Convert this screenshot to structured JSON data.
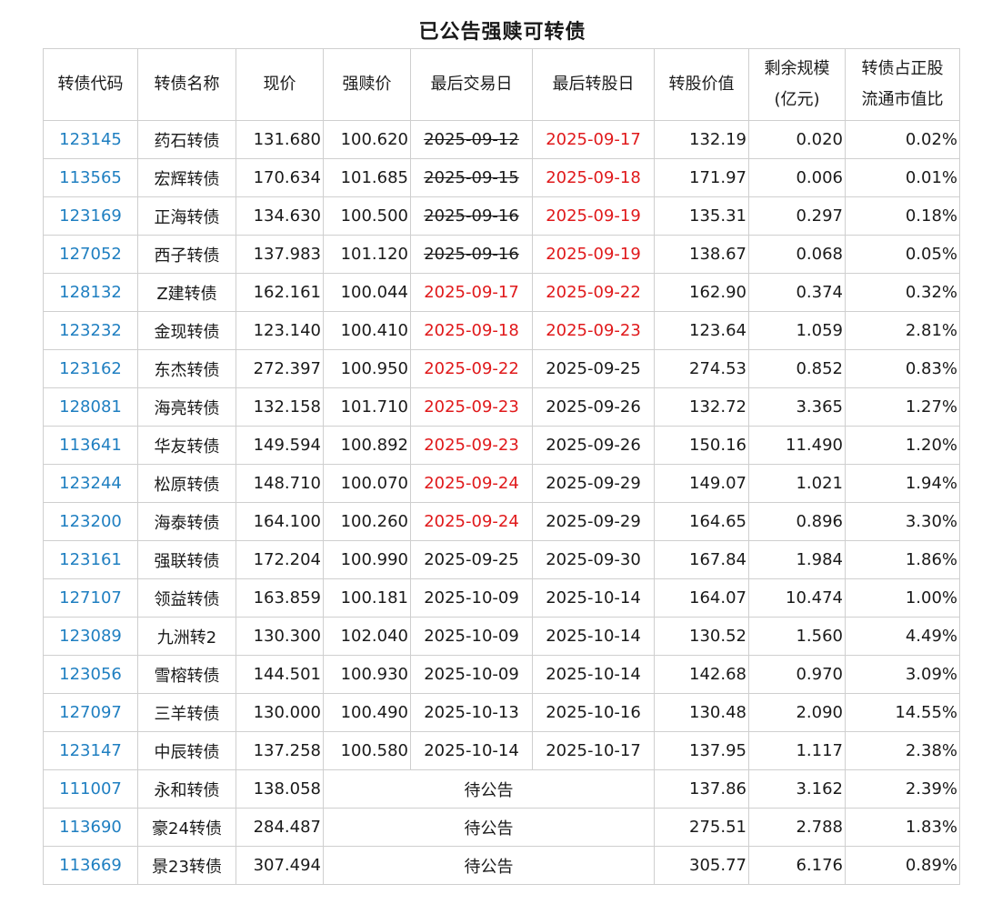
{
  "title": "已公告强赎可转债",
  "columns": [
    "转债代码",
    "转债名称",
    "现价",
    "强赎价",
    "最后交易日",
    "最后转股日",
    "转股价值",
    "剩余规模\n(亿元)",
    "转债占正股\n流通市值比"
  ],
  "rows": [
    {
      "code": "123145",
      "name": "药石转债",
      "price": "131.680",
      "redeem": "100.620",
      "last_trade": "2025-09-12",
      "last_trade_style": "strike",
      "last_convert": "2025-09-17",
      "last_convert_style": "red",
      "conv_value": "132.19",
      "remaining": "0.020",
      "ratio": "0.02%"
    },
    {
      "code": "113565",
      "name": "宏辉转债",
      "price": "170.634",
      "redeem": "101.685",
      "last_trade": "2025-09-15",
      "last_trade_style": "strike",
      "last_convert": "2025-09-18",
      "last_convert_style": "red",
      "conv_value": "171.97",
      "remaining": "0.006",
      "ratio": "0.01%"
    },
    {
      "code": "123169",
      "name": "正海转债",
      "price": "134.630",
      "redeem": "100.500",
      "last_trade": "2025-09-16",
      "last_trade_style": "strike",
      "last_convert": "2025-09-19",
      "last_convert_style": "red",
      "conv_value": "135.31",
      "remaining": "0.297",
      "ratio": "0.18%"
    },
    {
      "code": "127052",
      "name": "西子转债",
      "price": "137.983",
      "redeem": "101.120",
      "last_trade": "2025-09-16",
      "last_trade_style": "strike",
      "last_convert": "2025-09-19",
      "last_convert_style": "red",
      "conv_value": "138.67",
      "remaining": "0.068",
      "ratio": "0.05%"
    },
    {
      "code": "128132",
      "name": "Z建转债",
      "price": "162.161",
      "redeem": "100.044",
      "last_trade": "2025-09-17",
      "last_trade_style": "red",
      "last_convert": "2025-09-22",
      "last_convert_style": "red",
      "conv_value": "162.90",
      "remaining": "0.374",
      "ratio": "0.32%"
    },
    {
      "code": "123232",
      "name": "金现转债",
      "price": "123.140",
      "redeem": "100.410",
      "last_trade": "2025-09-18",
      "last_trade_style": "red",
      "last_convert": "2025-09-23",
      "last_convert_style": "red",
      "conv_value": "123.64",
      "remaining": "1.059",
      "ratio": "2.81%"
    },
    {
      "code": "123162",
      "name": "东杰转债",
      "price": "272.397",
      "redeem": "100.950",
      "last_trade": "2025-09-22",
      "last_trade_style": "red",
      "last_convert": "2025-09-25",
      "last_convert_style": "normal",
      "conv_value": "274.53",
      "remaining": "0.852",
      "ratio": "0.83%"
    },
    {
      "code": "128081",
      "name": "海亮转债",
      "price": "132.158",
      "redeem": "101.710",
      "last_trade": "2025-09-23",
      "last_trade_style": "red",
      "last_convert": "2025-09-26",
      "last_convert_style": "normal",
      "conv_value": "132.72",
      "remaining": "3.365",
      "ratio": "1.27%"
    },
    {
      "code": "113641",
      "name": "华友转债",
      "price": "149.594",
      "redeem": "100.892",
      "last_trade": "2025-09-23",
      "last_trade_style": "red",
      "last_convert": "2025-09-26",
      "last_convert_style": "normal",
      "conv_value": "150.16",
      "remaining": "11.490",
      "ratio": "1.20%"
    },
    {
      "code": "123244",
      "name": "松原转债",
      "price": "148.710",
      "redeem": "100.070",
      "last_trade": "2025-09-24",
      "last_trade_style": "red",
      "last_convert": "2025-09-29",
      "last_convert_style": "normal",
      "conv_value": "149.07",
      "remaining": "1.021",
      "ratio": "1.94%"
    },
    {
      "code": "123200",
      "name": "海泰转债",
      "price": "164.100",
      "redeem": "100.260",
      "last_trade": "2025-09-24",
      "last_trade_style": "red",
      "last_convert": "2025-09-29",
      "last_convert_style": "normal",
      "conv_value": "164.65",
      "remaining": "0.896",
      "ratio": "3.30%"
    },
    {
      "code": "123161",
      "name": "强联转债",
      "price": "172.204",
      "redeem": "100.990",
      "last_trade": "2025-09-25",
      "last_trade_style": "normal",
      "last_convert": "2025-09-30",
      "last_convert_style": "normal",
      "conv_value": "167.84",
      "remaining": "1.984",
      "ratio": "1.86%"
    },
    {
      "code": "127107",
      "name": "领益转债",
      "price": "163.859",
      "redeem": "100.181",
      "last_trade": "2025-10-09",
      "last_trade_style": "normal",
      "last_convert": "2025-10-14",
      "last_convert_style": "normal",
      "conv_value": "164.07",
      "remaining": "10.474",
      "ratio": "1.00%"
    },
    {
      "code": "123089",
      "name": "九洲转2",
      "price": "130.300",
      "redeem": "102.040",
      "last_trade": "2025-10-09",
      "last_trade_style": "normal",
      "last_convert": "2025-10-14",
      "last_convert_style": "normal",
      "conv_value": "130.52",
      "remaining": "1.560",
      "ratio": "4.49%"
    },
    {
      "code": "123056",
      "name": "雪榕转债",
      "price": "144.501",
      "redeem": "100.930",
      "last_trade": "2025-10-09",
      "last_trade_style": "normal",
      "last_convert": "2025-10-14",
      "last_convert_style": "normal",
      "conv_value": "142.68",
      "remaining": "0.970",
      "ratio": "3.09%"
    },
    {
      "code": "127097",
      "name": "三羊转债",
      "price": "130.000",
      "redeem": "100.490",
      "last_trade": "2025-10-13",
      "last_trade_style": "normal",
      "last_convert": "2025-10-16",
      "last_convert_style": "normal",
      "conv_value": "130.48",
      "remaining": "2.090",
      "ratio": "14.55%"
    },
    {
      "code": "123147",
      "name": "中辰转债",
      "price": "137.258",
      "redeem": "100.580",
      "last_trade": "2025-10-14",
      "last_trade_style": "normal",
      "last_convert": "2025-10-17",
      "last_convert_style": "normal",
      "conv_value": "137.95",
      "remaining": "1.117",
      "ratio": "2.38%"
    },
    {
      "code": "111007",
      "name": "永和转债",
      "price": "138.058",
      "pending": "待公告",
      "conv_value": "137.86",
      "remaining": "3.162",
      "ratio": "2.39%"
    },
    {
      "code": "113690",
      "name": "豪24转债",
      "price": "284.487",
      "pending": "待公告",
      "conv_value": "275.51",
      "remaining": "2.788",
      "ratio": "1.83%"
    },
    {
      "code": "113669",
      "name": "景23转债",
      "price": "307.494",
      "pending": "待公告",
      "conv_value": "305.77",
      "remaining": "6.176",
      "ratio": "0.89%"
    }
  ],
  "colors": {
    "code_link": "#1f7fc1",
    "highlight": "#e0191b",
    "border": "#cfcfcf"
  }
}
